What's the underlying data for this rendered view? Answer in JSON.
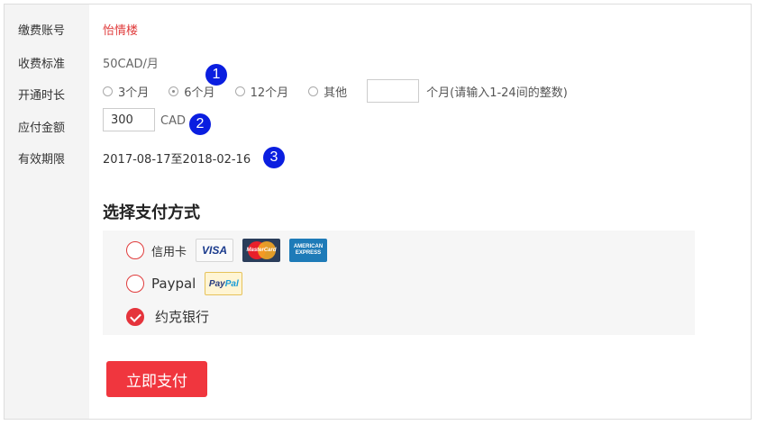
{
  "form": {
    "account_label": "缴费账号",
    "account_value": "怡情楼",
    "standard_label": "收费标准",
    "standard_value": "50CAD/月",
    "duration_label": "开通时长",
    "duration_options": [
      {
        "label": "3个月",
        "checked": false
      },
      {
        "label": "6个月",
        "checked": true
      },
      {
        "label": "12个月",
        "checked": false
      },
      {
        "label": "其他",
        "checked": false
      }
    ],
    "custom_months_value": "",
    "custom_months_hint": "个月(请输入1-24间的整数)",
    "amount_label": "应付金额",
    "amount_value": "300",
    "currency": "CAD",
    "validity_label": "有效期限",
    "validity_value": "2017-08-17至2018-02-16"
  },
  "badges": [
    "1",
    "2",
    "3"
  ],
  "payment": {
    "title": "选择支付方式",
    "methods": [
      {
        "name": "信用卡",
        "selected": false,
        "logos": [
          "visa-icon",
          "mastercard-icon",
          "amex-icon"
        ]
      },
      {
        "name": "Paypal",
        "selected": false,
        "logos": [
          "paypal-icon"
        ]
      },
      {
        "name": "约克银行",
        "selected": true,
        "logos": []
      }
    ],
    "logo_text": {
      "visa": "VISA",
      "mastercard": "MasterCard",
      "amex_line1": "AMERICAN",
      "amex_line2": "EXPRESS",
      "paypal_a": "Pay",
      "paypal_b": "Pal"
    },
    "submit_label": "立即支付"
  },
  "colors": {
    "accent_red": "#f0363e",
    "link_red": "#e03c3c",
    "badge_blue": "#0a1ee0",
    "label_bg": "#f4f4f4"
  }
}
